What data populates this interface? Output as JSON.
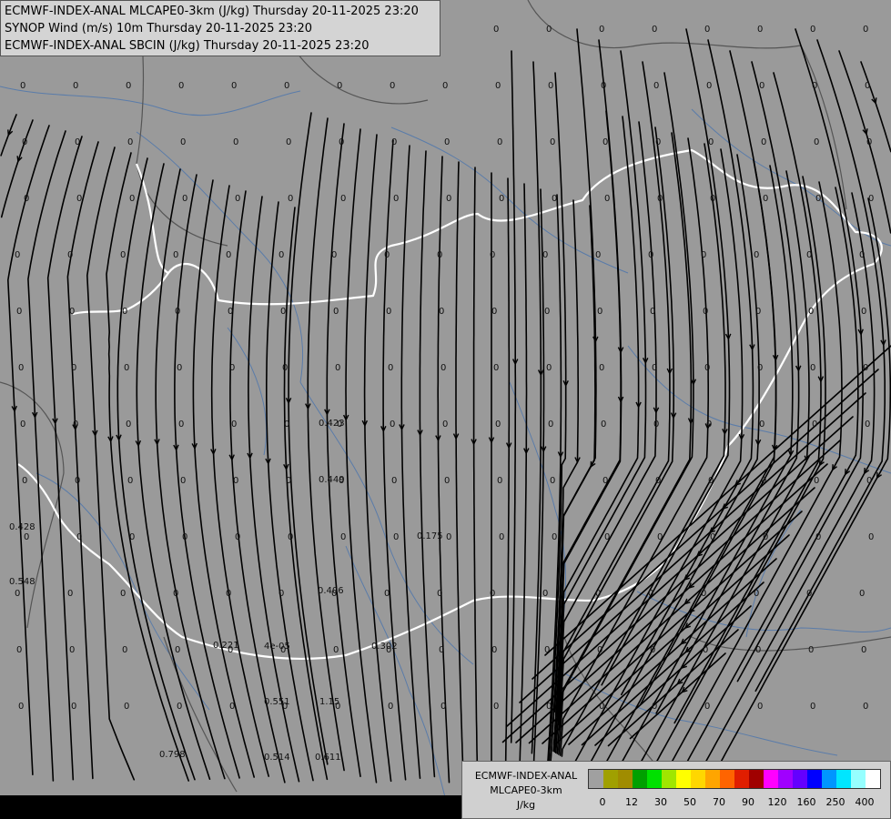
{
  "titles": [
    "ECMWF-INDEX-ANAL MLCAPE0-3km (J/kg) Thursday 20-11-2025 23:20",
    "SYNOP Wind (m/s) 10m Thursday 20-11-2025 23:20",
    "ECMWF-INDEX-ANAL SBCIN (J/kg) Thursday 20-11-2025 23:20"
  ],
  "legend": {
    "product_line1": "ECMWF-INDEX-ANAL",
    "product_line2": "MLCAPE0-3km",
    "unit": "J/kg",
    "colors": [
      "#a0a0a0",
      "#a0a000",
      "#a08c00",
      "#00a000",
      "#00e000",
      "#a0e600",
      "#ffff00",
      "#ffd700",
      "#ffa500",
      "#ff6400",
      "#e01e00",
      "#a00000",
      "#ff00ff",
      "#a000ff",
      "#6400ff",
      "#0000ff",
      "#0096ff",
      "#00e6ff",
      "#96ffff",
      "#ffffff"
    ],
    "ticks": [
      "0",
      "12",
      "30",
      "50",
      "70",
      "90",
      "120",
      "160",
      "250",
      "400"
    ]
  },
  "value_labels": [
    "0.423",
    "0.449",
    "0.175",
    "0.406",
    "0.221",
    "4e-05",
    "0.302",
    "0.551",
    "1.15",
    "0.798",
    "0.514",
    "0.611",
    "0.428",
    "0.548"
  ],
  "zero_label": "0"
}
